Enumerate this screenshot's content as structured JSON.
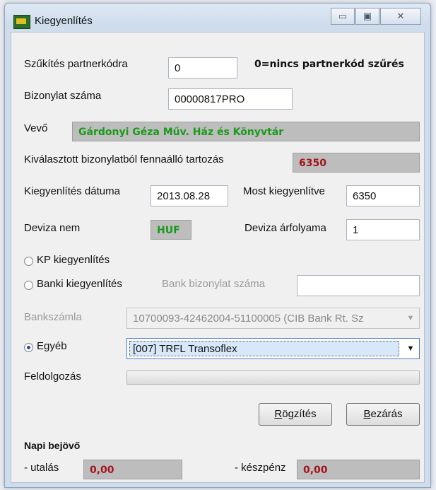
{
  "window": {
    "title": "Kiegyenlítés",
    "minimize_glyph": "▭",
    "maximize_glyph": "▣",
    "close_glyph": "✕"
  },
  "partner_filter": {
    "label": "Szűkítés partnerkódra",
    "value": "0",
    "hint": "0=nincs partnerkód szűrés"
  },
  "document_number": {
    "label": "Bizonylat száma",
    "value": "00000817PRO"
  },
  "customer": {
    "label": "Vevő",
    "value": "Gárdonyi Géza Műv. Ház és Könyvtár"
  },
  "outstanding": {
    "label": "Kiválasztott bizonylatból fennaálló tartozás",
    "value": "6350"
  },
  "settlement_date": {
    "label": "Kiegyenlítés dátuma",
    "value": "2013.08.28"
  },
  "settled_now": {
    "label": "Most kiegyenlítve",
    "value": "6350"
  },
  "currency": {
    "label": "Deviza nem",
    "value": "HUF"
  },
  "exchange_rate": {
    "label": "Deviza árfolyama",
    "value": "1"
  },
  "payment_options": {
    "cash": {
      "label": "KP kiegyenlítés",
      "selected": false
    },
    "bank": {
      "label": "Banki kiegyenlítés",
      "selected": false
    },
    "other": {
      "label": "Egyéb",
      "selected": true
    }
  },
  "bank_document": {
    "label": "Bank bizonylat száma",
    "value": ""
  },
  "bank_account": {
    "label": "Bankszámla",
    "value": "10700093-42462004-51100005 (CIB Bank Rt. Sz"
  },
  "other_partner": {
    "value": "[007] TRFL Transoflex"
  },
  "processing": {
    "label": "Feldolgozás",
    "progress": 0
  },
  "buttons": {
    "save": {
      "accel": "R",
      "rest": "ögzítés"
    },
    "close": {
      "accel": "B",
      "rest": "ezárás"
    }
  },
  "daily_incoming": {
    "title": "Napi bejövő",
    "transfer_label": "- utalás",
    "transfer_value": "0,00",
    "cash_label": "- készpénz",
    "cash_value": "0,00"
  },
  "colors": {
    "green_text": "#1a9a1a",
    "red_text": "#a3141c",
    "readonly_bg": "#bdbdbd"
  },
  "icons": {
    "app": "app-icon",
    "dropdown": "chevron-down-icon"
  }
}
